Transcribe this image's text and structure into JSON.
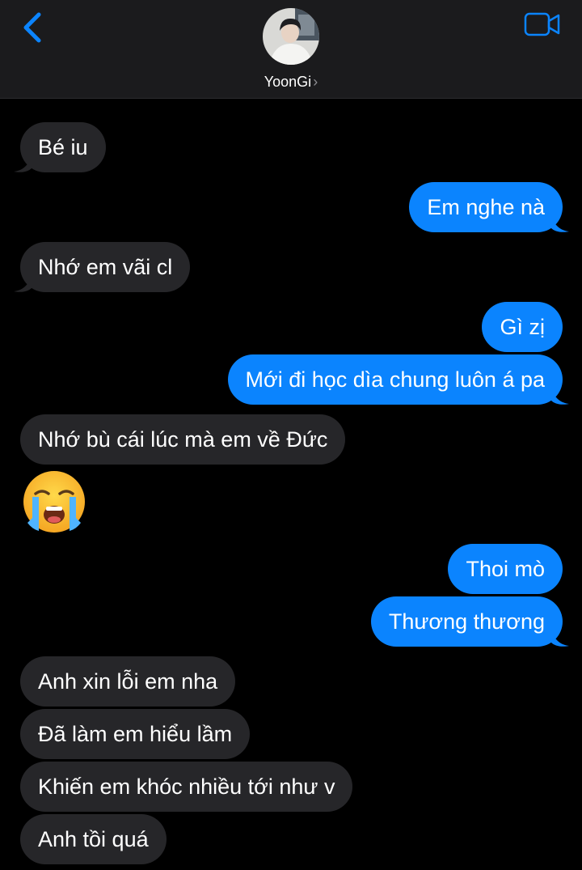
{
  "header": {
    "contact_name": "YoonGi",
    "chevron": "›",
    "back_icon": "chevron-left-icon",
    "video_icon": "video-camera-icon",
    "accent_color": "#0b84fe"
  },
  "messages": [
    {
      "id": "m1",
      "sender": "contact",
      "text": "Bé iu"
    },
    {
      "id": "m2",
      "sender": "me",
      "text": "Em nghe nà"
    },
    {
      "id": "m3",
      "sender": "contact",
      "text": "Nhớ em vãi cl"
    },
    {
      "id": "m4",
      "sender": "me",
      "text": "Gì zị"
    },
    {
      "id": "m5",
      "sender": "me",
      "text": "Mới đi học dìa chung luôn á pa"
    },
    {
      "id": "m6",
      "sender": "contact",
      "text": "Nhớ bù cái lúc mà em về Đức"
    },
    {
      "id": "m7",
      "sender": "contact",
      "emoji": "loudly-crying-face"
    },
    {
      "id": "m8",
      "sender": "me",
      "text": "Thoi mò"
    },
    {
      "id": "m9",
      "sender": "me",
      "text": "Thương thương"
    },
    {
      "id": "m10",
      "sender": "contact",
      "text": "Anh xin lỗi em nha"
    },
    {
      "id": "m11",
      "sender": "contact",
      "text": "Đã làm em hiểu lầm"
    },
    {
      "id": "m12",
      "sender": "contact",
      "text": "Khiến em khóc nhiều tới như v"
    },
    {
      "id": "m13",
      "sender": "contact",
      "text": "Anh tồi quá"
    }
  ],
  "colors": {
    "received_bubble": "#262629",
    "sent_bubble": "#0b84fe",
    "header_bg": "#1b1b1d",
    "background": "#000000"
  }
}
